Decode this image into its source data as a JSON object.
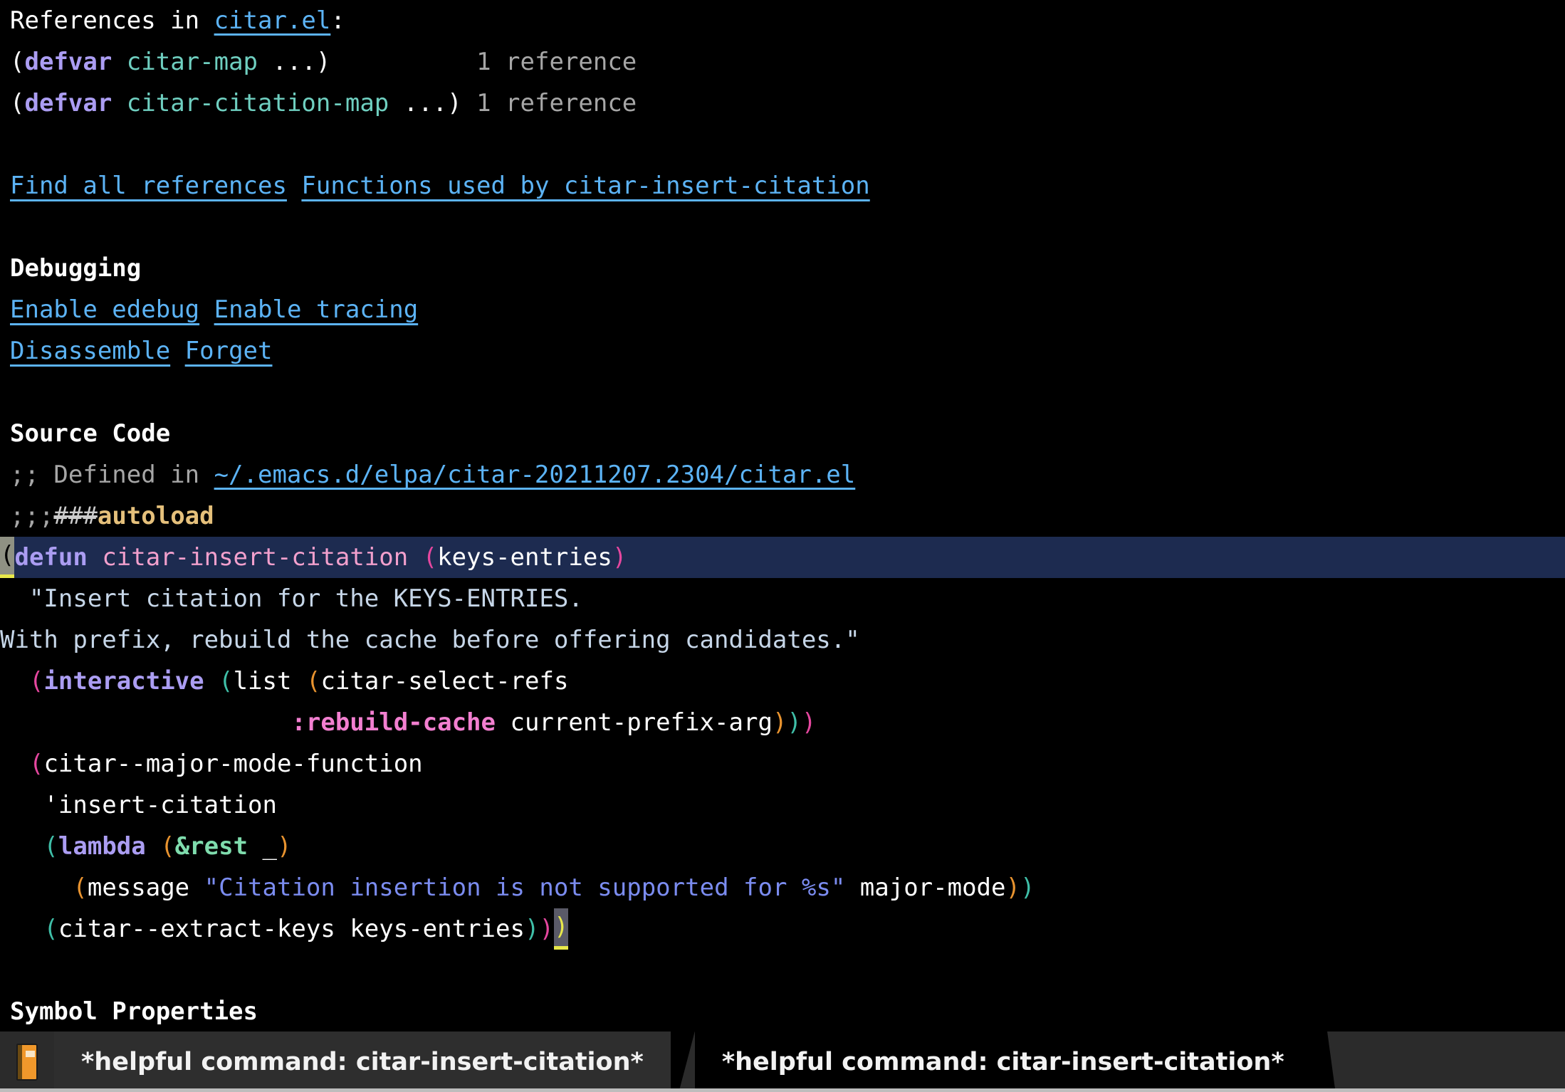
{
  "window": {
    "background": "#000000",
    "foreground": "#ffffff"
  },
  "buffer": {
    "references_heading": {
      "prefix": "References in ",
      "file_link": "citar.el",
      "suffix": ":"
    },
    "references": [
      {
        "open_paren": "(",
        "keyword": "defvar",
        "space": " ",
        "symbol": "citar-map",
        "tail": " ...)",
        "pad": "          ",
        "count": "1 reference"
      },
      {
        "open_paren": "(",
        "keyword": "defvar",
        "space": " ",
        "symbol": "citar-citation-map",
        "tail": " ...)",
        "pad": " ",
        "count": "1 reference"
      }
    ],
    "reference_actions": [
      "Find all references",
      "Functions used by citar-insert-citation"
    ],
    "debugging": {
      "title": "Debugging",
      "buttons_row1": [
        "Enable edebug",
        "Enable tracing"
      ],
      "buttons_row2": [
        "Disassemble",
        "Forget"
      ]
    },
    "source_code": {
      "title": "Source Code",
      "defined_in_prefix": ";; Defined in ",
      "defined_in_path": "~/.emacs.d/elpa/citar-20211207.2304/citar.el",
      "autoload": {
        "semis": ";;;",
        "hashes": "###",
        "word": "autoload"
      },
      "code": {
        "l1": {
          "cursor_char": "(",
          "keyword": "defun",
          "sp1": " ",
          "name": "citar-insert-citation",
          "sp2": " ",
          "arg_open": "(",
          "args": "keys-entries",
          "arg_close": ")"
        },
        "l2": "  \"Insert citation for the KEYS-ENTRIES.",
        "l3": "With prefix, rebuild the cache before offering candidates.\"",
        "l4": {
          "indent": "  ",
          "p_open": "(",
          "interactive": "interactive",
          "sp1": " ",
          "p_open2": "(",
          "list": "list",
          "sp2": " ",
          "p_open3": "(",
          "fn": "citar-select-refs"
        },
        "l5": {
          "indent": "                    ",
          "keyword_arg": ":rebuild-cache",
          "sp": " ",
          "symbol": "current-prefix-arg",
          "close3": ")",
          "close2": ")",
          "close1": ")"
        },
        "l6": {
          "indent": "  ",
          "p_open": "(",
          "sym": "citar--major-mode-function"
        },
        "l7": "   'insert-citation",
        "l8": {
          "indent": "   ",
          "p_open2": "(",
          "lambda": "lambda",
          "sp1": " ",
          "p_open3": "(",
          "amprest": "&rest",
          "sp2": " ",
          "underscore": "_",
          "close3": ")"
        },
        "l9": {
          "indent": "     ",
          "p_open4": "(",
          "fn": "message",
          "sp1": " ",
          "string": "\"Citation insertion is not supported for %s\"",
          "sp2": " ",
          "symbol": "major-mode",
          "close4": ")",
          "close2": ")"
        },
        "l10": {
          "indent": "   ",
          "p_open2": "(",
          "fn": "citar--extract-keys",
          "sp1": " ",
          "arg": "keys-entries",
          "close2": ")",
          "close1": ")",
          "close0": ")"
        }
      }
    },
    "symbol_properties_title": "Symbol Properties"
  },
  "tabbar": {
    "icon": "book-icon",
    "tabs": [
      {
        "label": "*helpful command: citar-insert-citation*",
        "active": false
      },
      {
        "label": "*helpful command: citar-insert-citation*",
        "active": true
      }
    ]
  },
  "colors": {
    "link": "#5cb3f5",
    "keyword": "#ab9df2",
    "variable": "#6fcfc0",
    "function_name": "#f2a0cd",
    "docstring": "#c6d6e8",
    "string": "#7b8cf0",
    "keyword_arg": "#f27fd0",
    "amprest": "#7fdcad",
    "autoload": "#e5c07b",
    "paren_depth1": "#e5479f",
    "paren_depth2": "#3fbfa8",
    "paren_depth3": "#e8932f",
    "hl_line_bg": "#1d2b50",
    "cursor_bg": "#8f9183",
    "paren_match_bg": "#5a5a68",
    "comment": "#a6a6a6",
    "tabbar_bg": "#2b2b2b",
    "tab_inactive_bg": "#2e2e2e",
    "tab_active_bg": "#000000"
  }
}
